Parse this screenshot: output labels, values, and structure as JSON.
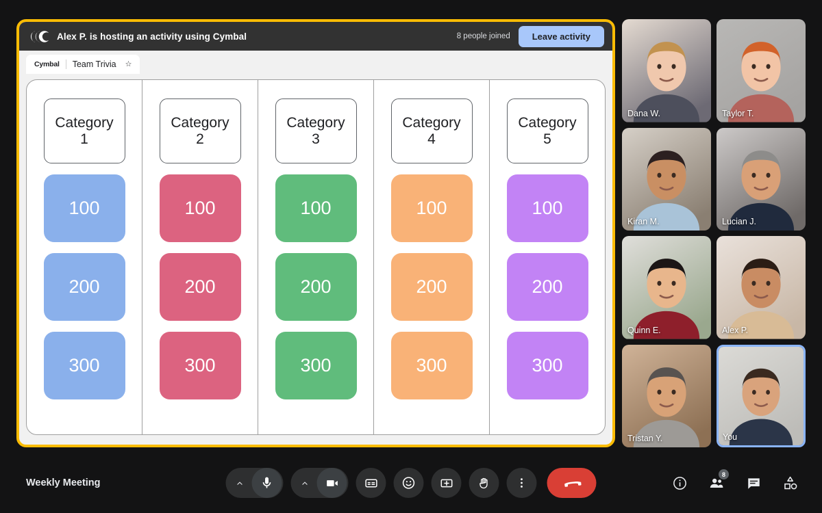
{
  "activity": {
    "header_title": "Alex P. is hosting an activity using Cymbal",
    "logo_name": "Cymbal",
    "people_joined": "8 people joined",
    "leave_label": "Leave activity",
    "tab": {
      "brand": "Cymbal",
      "name": "Team Trivia",
      "star": "☆"
    },
    "frame_color": "#FBBC04",
    "leave_button_color": "#A8C7FA"
  },
  "board": {
    "columns": [
      {
        "category": "Category 1",
        "color": "#8AB0EB",
        "values": [
          "100",
          "200",
          "300"
        ]
      },
      {
        "category": "Category 2",
        "color": "#DC6380",
        "values": [
          "100",
          "200",
          "300"
        ]
      },
      {
        "category": "Category 3",
        "color": "#60BC7C",
        "values": [
          "100",
          "200",
          "300"
        ]
      },
      {
        "category": "Category 4",
        "color": "#F9B277",
        "values": [
          "100",
          "200",
          "300"
        ]
      },
      {
        "category": "Category 5",
        "color": "#C283F5",
        "values": [
          "100",
          "200",
          "300"
        ]
      }
    ]
  },
  "participants": [
    {
      "name": "Dana W.",
      "self": false,
      "bg1": "#e8ded4",
      "bg2": "#6d6a74",
      "skin": "#f0c8ad",
      "hair": "#c2924f",
      "shirt": "#4d4f5c"
    },
    {
      "name": "Taylor T.",
      "self": false,
      "bg1": "#b9b8b6",
      "bg2": "#a5a3a1",
      "skin": "#f2c4a6",
      "hair": "#d2622a",
      "shirt": "#b4635c"
    },
    {
      "name": "Kiran M.",
      "self": false,
      "bg1": "#d8d2ca",
      "bg2": "#8a7f72",
      "skin": "#c98f63",
      "hair": "#2c2020",
      "shirt": "#a9c3d8"
    },
    {
      "name": "Lucian J.",
      "self": false,
      "bg1": "#cfcccb",
      "bg2": "#6f6a68",
      "skin": "#d9a077",
      "hair": "#8d8c8a",
      "shirt": "#202a3d"
    },
    {
      "name": "Quinn E.",
      "self": false,
      "bg1": "#e2e0dd",
      "bg2": "#9aa88e",
      "skin": "#e8b68c",
      "hair": "#1c1616",
      "shirt": "#8e1f2b"
    },
    {
      "name": "Alex P.",
      "self": false,
      "bg1": "#eae2dc",
      "bg2": "#c8b7a6",
      "skin": "#c98c63",
      "hair": "#2b1d15",
      "shirt": "#d8bb96"
    },
    {
      "name": "Tristan Y.",
      "self": false,
      "bg1": "#d2b59a",
      "bg2": "#8d7054",
      "skin": "#d8a277",
      "hair": "#585350",
      "shirt": "#9d9a96"
    },
    {
      "name": "You",
      "self": true,
      "bg1": "#dcdbd7",
      "bg2": "#bdbcb8",
      "skin": "#d9a37c",
      "hair": "#3a2a20",
      "shirt": "#2b3548"
    }
  ],
  "bottom": {
    "meeting_name": "Weekly Meeting",
    "controls": [
      {
        "id": "microphone",
        "label": "Microphone",
        "has_chevron": true
      },
      {
        "id": "camera",
        "label": "Camera",
        "has_chevron": true
      },
      {
        "id": "captions",
        "label": "Captions",
        "has_chevron": false
      },
      {
        "id": "reactions",
        "label": "Reactions",
        "has_chevron": false
      },
      {
        "id": "present",
        "label": "Present now",
        "has_chevron": false
      },
      {
        "id": "raise-hand",
        "label": "Raise hand",
        "has_chevron": false
      },
      {
        "id": "more-options",
        "label": "More options",
        "has_chevron": false
      }
    ],
    "end_call_label": "Leave call",
    "right_icons": [
      {
        "id": "meeting-details",
        "label": "Meeting details",
        "badge": ""
      },
      {
        "id": "people",
        "label": "People",
        "badge": "8"
      },
      {
        "id": "chat",
        "label": "Chat with everyone",
        "badge": ""
      },
      {
        "id": "activities",
        "label": "Activities",
        "badge": ""
      }
    ]
  }
}
